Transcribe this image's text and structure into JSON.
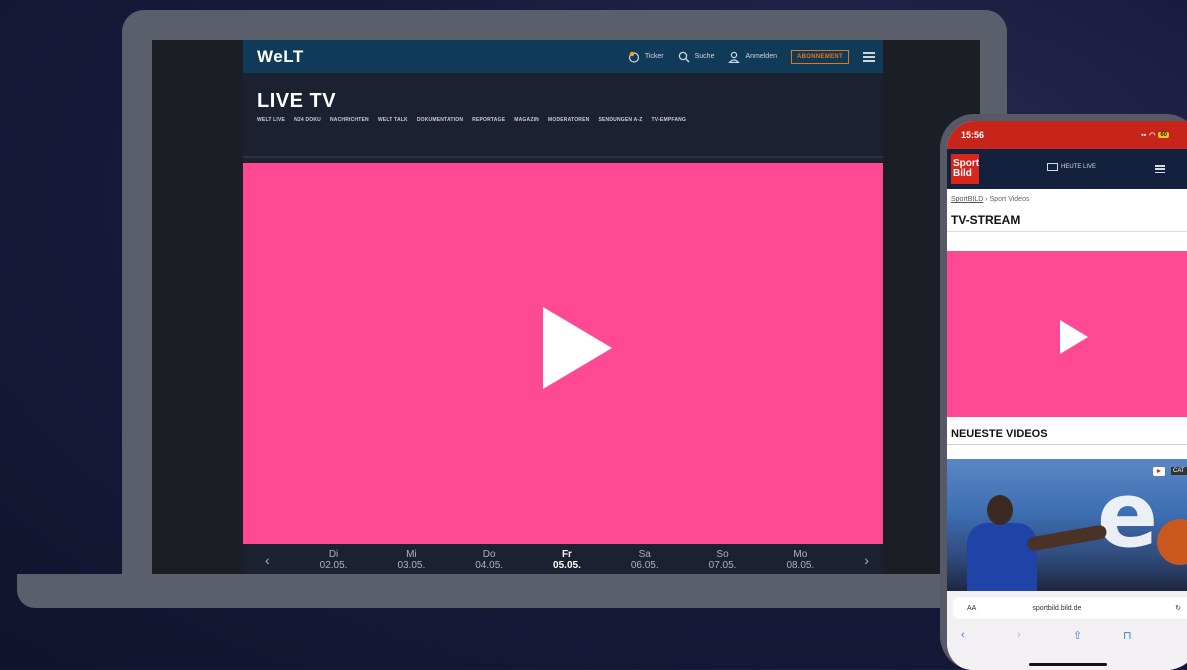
{
  "laptop": {
    "header": {
      "logo": "WeLT",
      "ticker_label": "Ticker",
      "search_label": "Suche",
      "login_label": "Anmelden",
      "subscribe_label": "ABONNEMENT"
    },
    "page_title": "LIVE TV",
    "tabs": [
      "WELT LIVE",
      "N24 DOKU",
      "NACHRICHTEN",
      "WELT TALK",
      "DOKUMENTATION",
      "REPORTAGE",
      "MAGAZIN",
      "MODERATOREN",
      "SENDUNGEN A-Z",
      "TV-EMPFANG"
    ],
    "dates": [
      {
        "day": "Di",
        "date": "02.05."
      },
      {
        "day": "Mi",
        "date": "03.05."
      },
      {
        "day": "Do",
        "date": "04.05."
      },
      {
        "day": "Fr",
        "date": "05.05."
      },
      {
        "day": "Sa",
        "date": "06.05."
      },
      {
        "day": "So",
        "date": "07.05."
      },
      {
        "day": "Mo",
        "date": "08.05."
      }
    ],
    "active_date_index": 3,
    "video_color": "#ff4a93"
  },
  "phone": {
    "time": "15:56",
    "battery": "60",
    "logo_line1": "Sport",
    "logo_line2": "Bild",
    "live_label": "HEUTE LIVE",
    "breadcrumb_root": "SportBILD",
    "breadcrumb_rest": " › Sport Videos",
    "title": "TV-STREAM",
    "latest_title": "NEUESTE VIDEOS",
    "thumb_badge": "CAT",
    "url_aa": "AA",
    "url": "sportbild.bild.de",
    "toolbar": {
      "back": "‹",
      "forward": "›",
      "share": "⇧",
      "bookmarks": "⊓"
    }
  }
}
